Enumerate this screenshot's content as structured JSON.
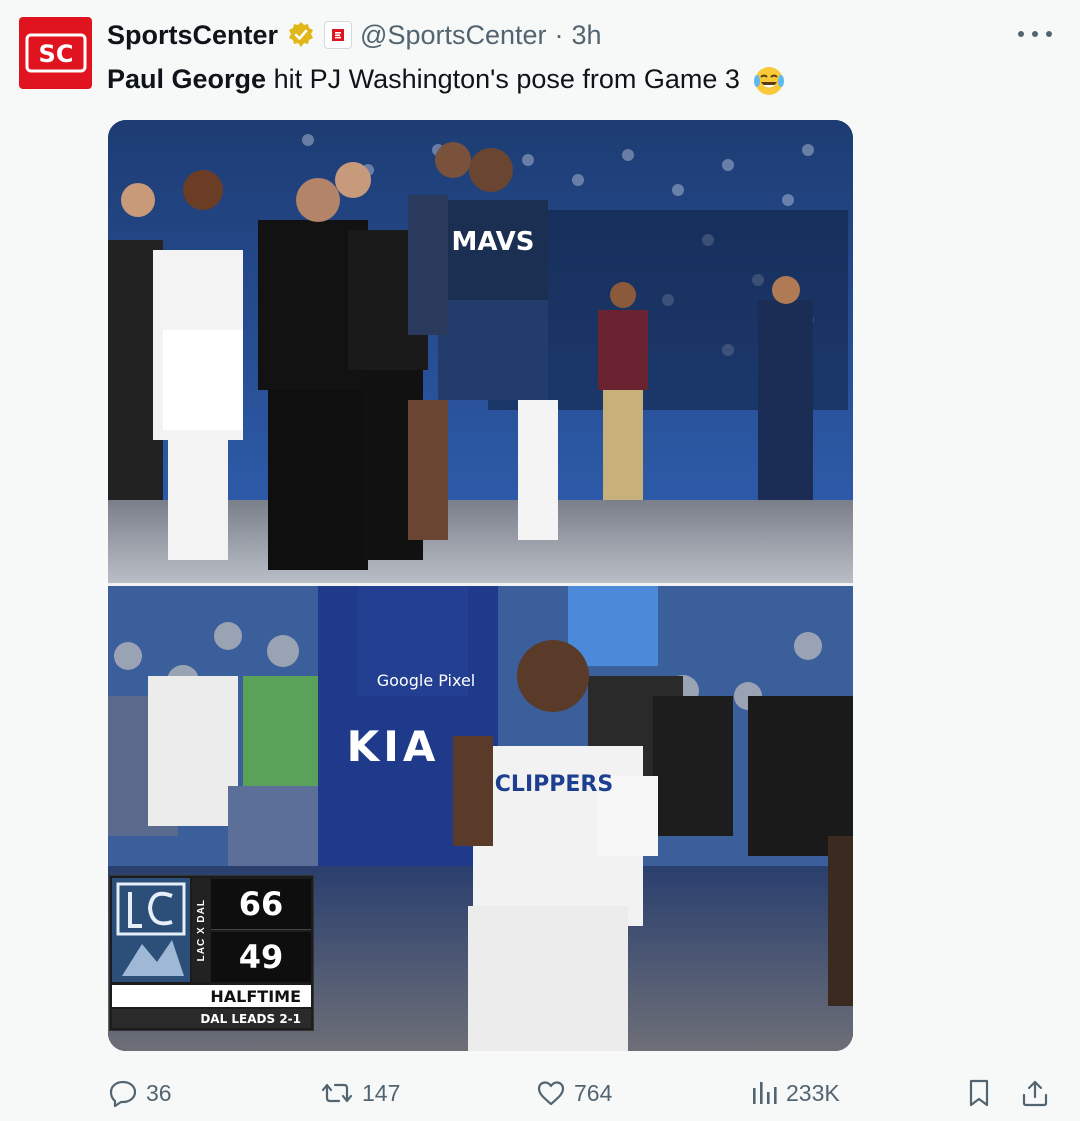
{
  "tweet": {
    "author_name": "SportsCenter",
    "handle": "@SportsCenter",
    "dot": "·",
    "time": "3h",
    "text_bold": "Paul George",
    "text_rest": "hit PJ Washington's pose from Game 3",
    "emoji": "face-with-tears-of-joy"
  },
  "media": {
    "scorebug": {
      "teams": "LAC X DAL",
      "home_score": "66",
      "away_score": "49",
      "status": "HALFTIME",
      "series": "DAL LEADS 2-1"
    },
    "signage": {
      "banner": "Google Pixel",
      "brand": "KIA",
      "jersey_top": "MAVS",
      "jersey_bottom": "CLIPPERS"
    }
  },
  "actions": {
    "replies": "36",
    "reposts": "147",
    "likes": "764",
    "views": "233K"
  },
  "colors": {
    "brand_red": "#e0141e",
    "text": "#0f1419",
    "muted": "#536471",
    "verified_gold": "#e2b719"
  }
}
